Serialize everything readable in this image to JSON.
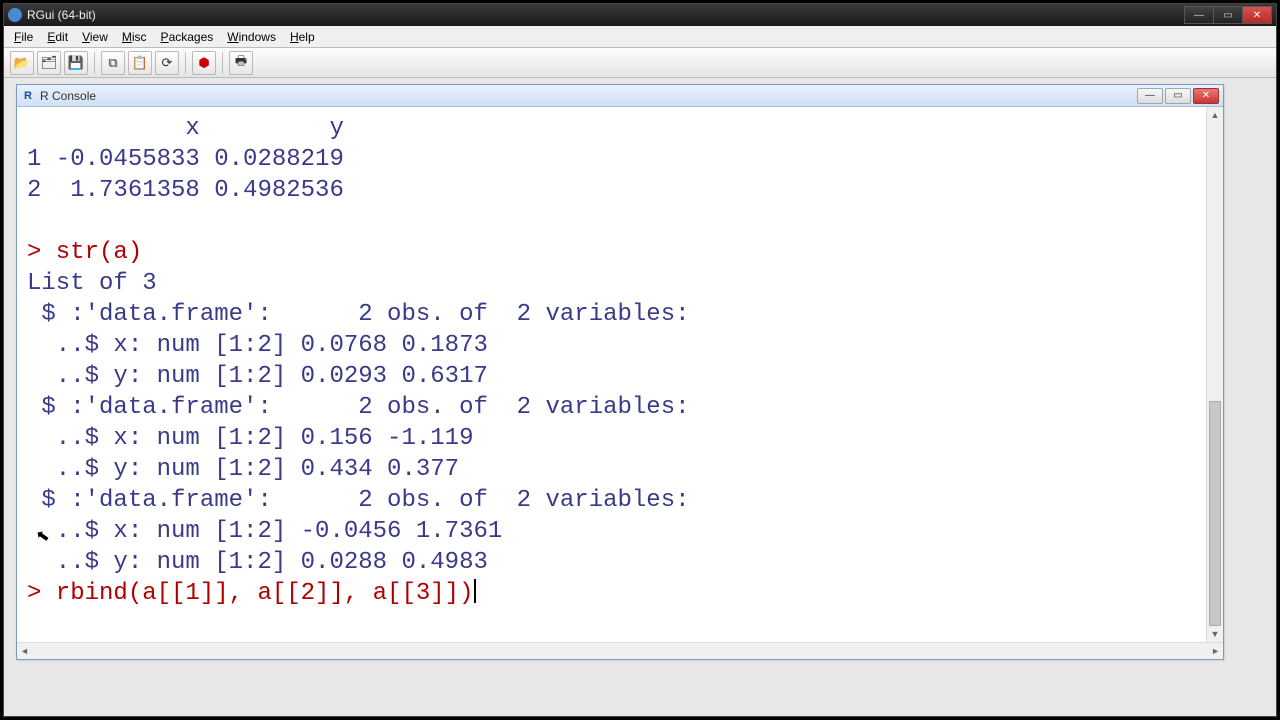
{
  "window": {
    "title": "RGui (64-bit)"
  },
  "menus": {
    "file": "File",
    "edit": "Edit",
    "view": "View",
    "misc": "Misc",
    "packages": "Packages",
    "windows": "Windows",
    "help": "Help"
  },
  "console": {
    "title": "R Console",
    "output": {
      "header": "           x         y",
      "row1": "1 -0.0455833 0.0288219",
      "row2": "2  1.7361358 0.4982536",
      "blank": "",
      "cmd1": "> str(a)",
      "l1": "List of 3",
      "l2": " $ :'data.frame':      2 obs. of  2 variables:",
      "l3": "  ..$ x: num [1:2] 0.0768 0.1873",
      "l4": "  ..$ y: num [1:2] 0.0293 0.6317",
      "l5": " $ :'data.frame':      2 obs. of  2 variables:",
      "l6": "  ..$ x: num [1:2] 0.156 -1.119",
      "l7": "  ..$ y: num [1:2] 0.434 0.377",
      "l8": " $ :'data.frame':      2 obs. of  2 variables:",
      "l9": "  ..$ x: num [1:2] -0.0456 1.7361",
      "l10": "  ..$ y: num [1:2] 0.0288 0.4983",
      "cmd2": "> rbind(a[[1]], a[[2]], a[[3]])"
    }
  }
}
